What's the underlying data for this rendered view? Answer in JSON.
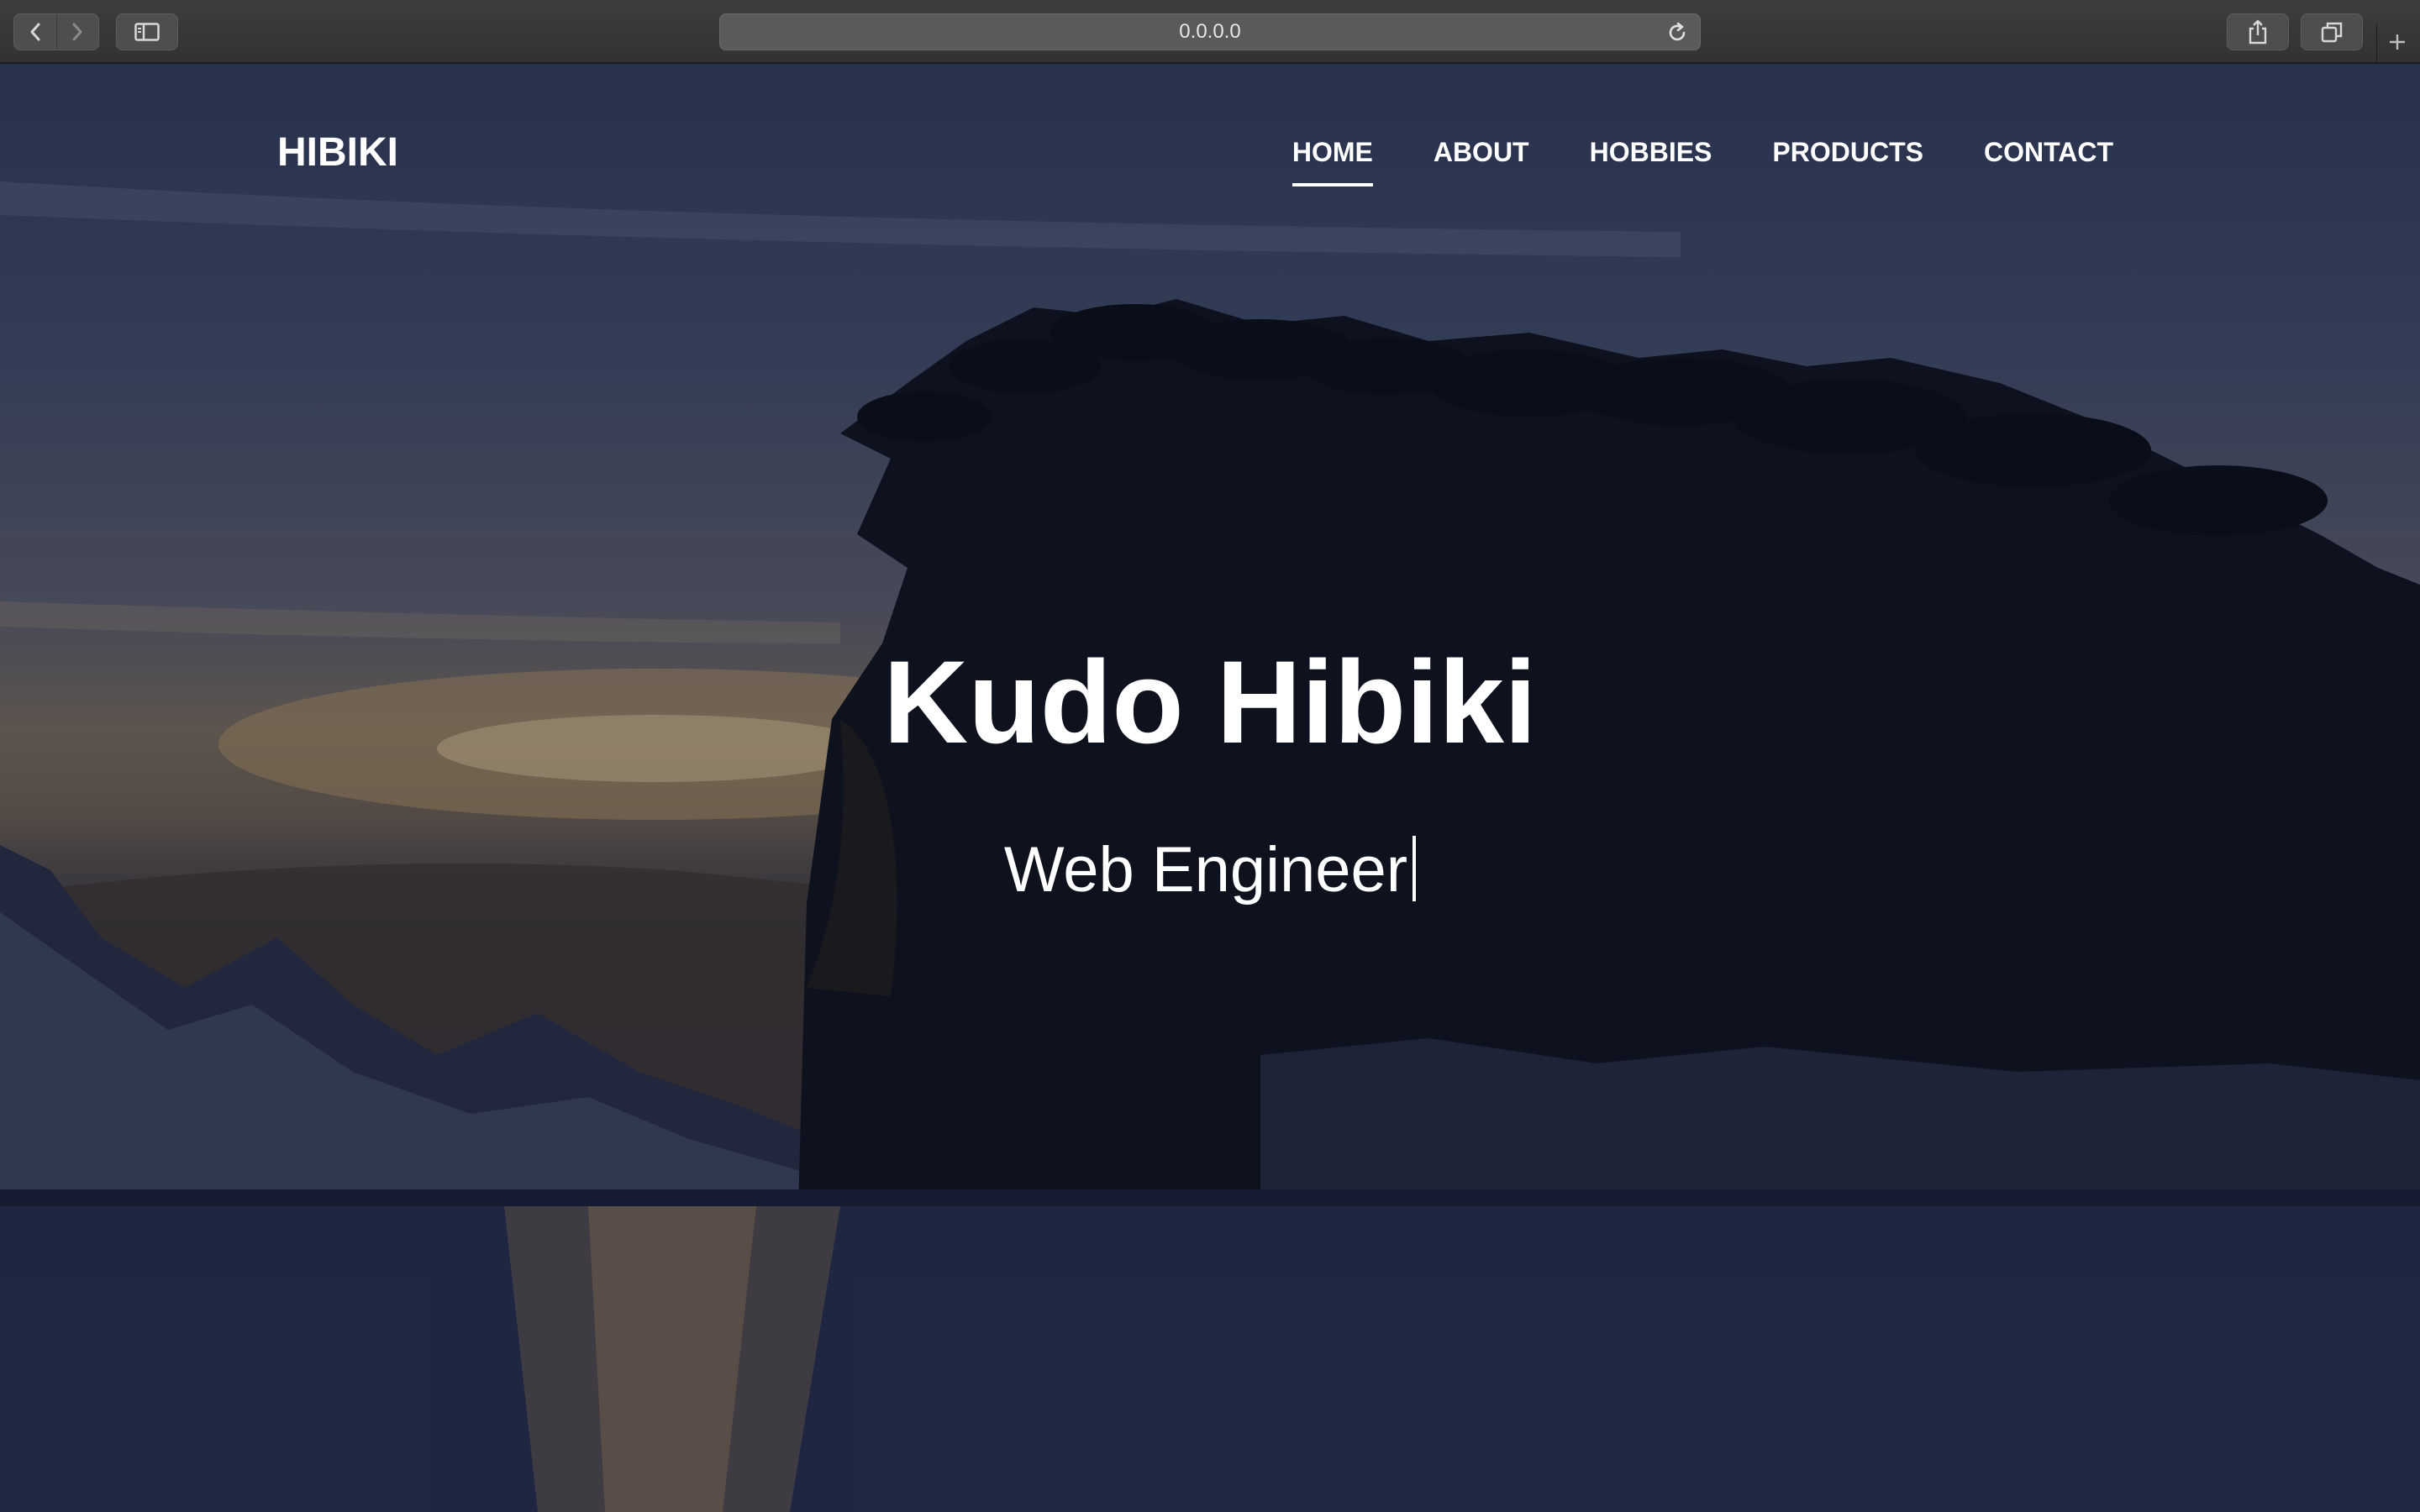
{
  "browser": {
    "address": "0.0.0.0",
    "back_icon": "chevron-left-icon",
    "forward_icon": "chevron-right-icon",
    "sidebar_icon": "sidebar-icon",
    "reload_icon": "reload-icon",
    "share_icon": "share-icon",
    "tabs_icon": "tabs-icon",
    "new_tab_icon": "plus-icon"
  },
  "site": {
    "brand": "HIBIKI",
    "nav": [
      {
        "label": "HOME",
        "active": true
      },
      {
        "label": "ABOUT",
        "active": false
      },
      {
        "label": "HOBBIES",
        "active": false
      },
      {
        "label": "PRODUCTS",
        "active": false
      },
      {
        "label": "CONTACT",
        "active": false
      }
    ]
  },
  "hero": {
    "title": "Kudo Hibiki",
    "subtitle": "Web Engineer"
  },
  "colors": {
    "text": "#ffffff",
    "chrome": "#3a3a3c",
    "overlay": "#0a0e1e"
  }
}
